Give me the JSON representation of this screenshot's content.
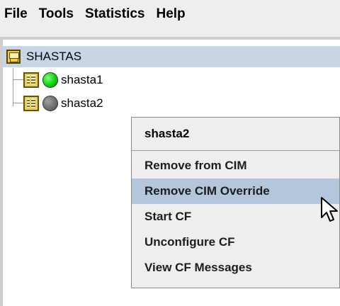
{
  "menubar": {
    "items": [
      "File",
      "Tools",
      "Statistics",
      "Help"
    ]
  },
  "tree": {
    "root": {
      "label": "SHASTAS",
      "icon": "cluster-icon"
    },
    "nodes": [
      {
        "label": "shasta1",
        "status": "online",
        "status_color": "#00d000",
        "icon": "node-icon"
      },
      {
        "label": "shasta2",
        "status": "unknown",
        "status_color": "#6a6a6a",
        "icon": "node-icon"
      }
    ]
  },
  "context_menu": {
    "title": "shasta2",
    "items": [
      "Remove from CIM",
      "Remove CIM Override",
      "Start CF",
      "Unconfigure CF",
      "View CF Messages"
    ],
    "highlighted_index": 1,
    "highlight_color": "#b4c6dc"
  }
}
